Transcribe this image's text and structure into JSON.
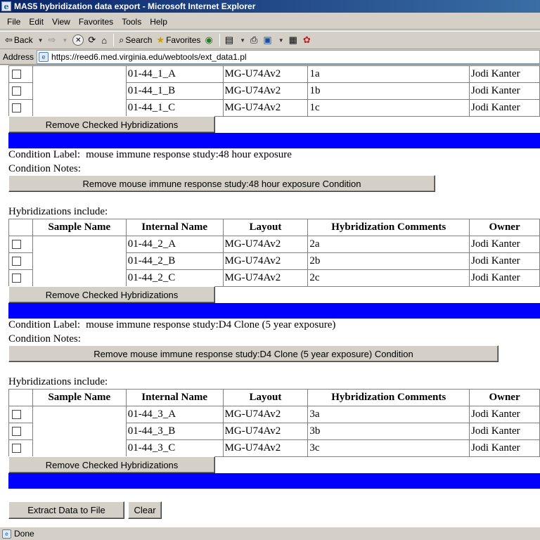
{
  "window": {
    "title": "MAS5 hybridization data export - Microsoft Internet Explorer"
  },
  "menu": [
    "File",
    "Edit",
    "View",
    "Favorites",
    "Tools",
    "Help"
  ],
  "toolbar": {
    "back": "Back",
    "search": "Search",
    "favorites": "Favorites"
  },
  "address": {
    "label": "Address",
    "url": "https://reed6.med.virginia.edu/webtools/ext_data1.pl"
  },
  "table_headers": [
    "Sample Name",
    "Internal Name",
    "Layout",
    "Hybridization Comments",
    "Owner"
  ],
  "group1": {
    "rows": [
      {
        "internal": "01-44_1_A",
        "layout": "MG-U74Av2",
        "comment": "1a",
        "owner": "Jodi Kanter"
      },
      {
        "internal": "01-44_1_B",
        "layout": "MG-U74Av2",
        "comment": "1b",
        "owner": "Jodi Kanter"
      },
      {
        "internal": "01-44_1_C",
        "layout": "MG-U74Av2",
        "comment": "1c",
        "owner": "Jodi Kanter"
      }
    ],
    "remove_btn": "Remove Checked Hybridizations"
  },
  "condition2": {
    "label_caption": "Condition Label:",
    "label_value": "mouse immune response study:48 hour exposure",
    "notes_caption": "Condition Notes:",
    "remove_condition_btn": "Remove mouse immune response study:48 hour exposure Condition",
    "hyb_include": "Hybridizations include:",
    "rows": [
      {
        "internal": "01-44_2_A",
        "layout": "MG-U74Av2",
        "comment": "2a",
        "owner": "Jodi Kanter"
      },
      {
        "internal": "01-44_2_B",
        "layout": "MG-U74Av2",
        "comment": "2b",
        "owner": "Jodi Kanter"
      },
      {
        "internal": "01-44_2_C",
        "layout": "MG-U74Av2",
        "comment": "2c",
        "owner": "Jodi Kanter"
      }
    ],
    "remove_btn": "Remove Checked Hybridizations"
  },
  "condition3": {
    "label_caption": "Condition Label:",
    "label_value": "mouse immune response study:D4 Clone (5 year exposure)",
    "notes_caption": "Condition Notes:",
    "remove_condition_btn": "Remove mouse immune response study:D4 Clone (5 year exposure) Condition",
    "hyb_include": "Hybridizations include:",
    "rows": [
      {
        "internal": "01-44_3_A",
        "layout": "MG-U74Av2",
        "comment": "3a",
        "owner": "Jodi Kanter"
      },
      {
        "internal": "01-44_3_B",
        "layout": "MG-U74Av2",
        "comment": "3b",
        "owner": "Jodi Kanter"
      },
      {
        "internal": "01-44_3_C",
        "layout": "MG-U74Av2",
        "comment": "3c",
        "owner": "Jodi Kanter"
      }
    ],
    "remove_btn": "Remove Checked Hybridizations"
  },
  "actions": {
    "extract": "Extract Data to File",
    "clear": "Clear"
  },
  "status": {
    "text": "Done"
  },
  "colors": {
    "condition_bar": "#0000ff",
    "titlebar": "#0a246a"
  }
}
